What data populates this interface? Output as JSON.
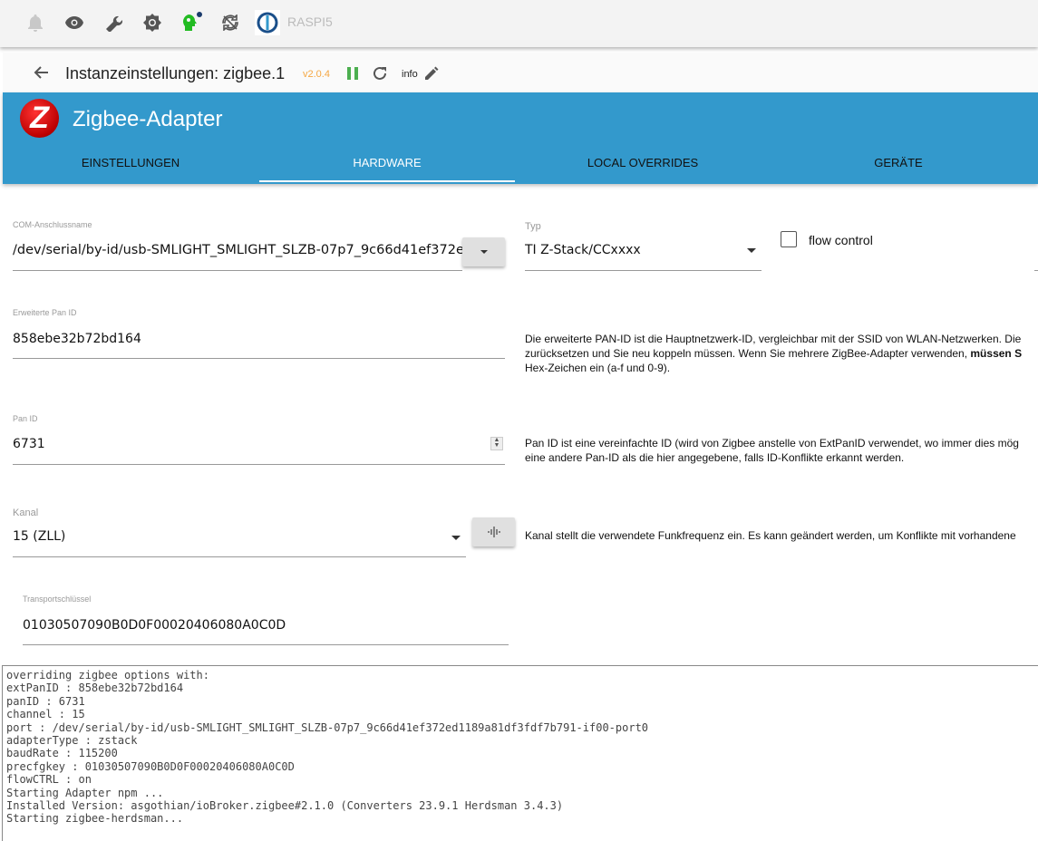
{
  "topbar": {
    "host": "RASPI5",
    "icons": [
      "bell-icon",
      "eye-icon",
      "wrench-icon",
      "gear-icon",
      "head-icon",
      "sync-off-icon",
      "iobroker-logo"
    ]
  },
  "header": {
    "title": "Instanzeinstellungen: zigbee.1",
    "version": "v2.0.4",
    "info": "info"
  },
  "banner": {
    "title": "Zigbee-Adapter",
    "tabs": [
      "EINSTELLUNGEN",
      "HARDWARE",
      "LOCAL OVERRIDES",
      "GERÄTE"
    ],
    "active_tab": "HARDWARE"
  },
  "form": {
    "com": {
      "label": "COM-Anschlussname",
      "value": "/dev/serial/by-id/usb-SMLIGHT_SMLIGHT_SLZB-07p7_9c66d41ef372ed1189a81df3fdf7b791-if00-port0"
    },
    "typ": {
      "label": "Typ",
      "value": "TI Z-Stack/CCxxxx"
    },
    "flow": {
      "label": "flow control",
      "checked": false
    },
    "extpan": {
      "label": "Erweiterte Pan ID",
      "value": "858ebe32b72bd164",
      "desc1": "Die erweiterte PAN-ID ist die Hauptnetzwerk-ID, vergleichbar mit der SSID von WLAN-Netzwerken. Die",
      "desc2a": "zurücksetzen und Sie neu koppeln müssen. Wenn Sie mehrere ZigBee-Adapter verwenden, ",
      "desc2b": "müssen S",
      "desc3": "Hex-Zeichen ein (a-f und 0-9)."
    },
    "pan": {
      "label": "Pan ID",
      "value": "6731",
      "desc1": "Pan ID ist eine vereinfachte ID (wird von Zigbee anstelle von ExtPanID verwendet, wo immer dies mög",
      "desc2": "eine andere Pan-ID als die hier angegebene, falls ID-Konflikte erkannt werden."
    },
    "kanal": {
      "label": "Kanal",
      "value": "15 (ZLL)",
      "desc": "Kanal stellt die verwendete Funkfrequenz ein. Es kann geändert werden, um Konflikte mit vorhandene"
    },
    "key": {
      "label": "Transportschlüssel",
      "value": "01030507090B0D0F00020406080A0C0D"
    }
  },
  "console": [
    "overriding zigbee options with:",
    "extPanID : 858ebe32b72bd164",
    "panID : 6731",
    "channel : 15",
    "port : /dev/serial/by-id/usb-SMLIGHT_SMLIGHT_SLZB-07p7_9c66d41ef372ed1189a81df3fdf7b791-if00-port0",
    "adapterType : zstack",
    "baudRate : 115200",
    "precfgkey : 01030507090B0D0F00020406080A0C0D",
    "flowCTRL : on",
    "Starting Adapter npm ...",
    "Installed Version: asgothian/ioBroker.zigbee#2.1.0 (Converters 23.9.1 Herdsman 3.4.3)",
    "Starting zigbee-herdsman..."
  ],
  "colors": {
    "banner": "#3399cc",
    "version": "#f5a742",
    "pause": "#4caf50",
    "head": "#22bb22"
  }
}
